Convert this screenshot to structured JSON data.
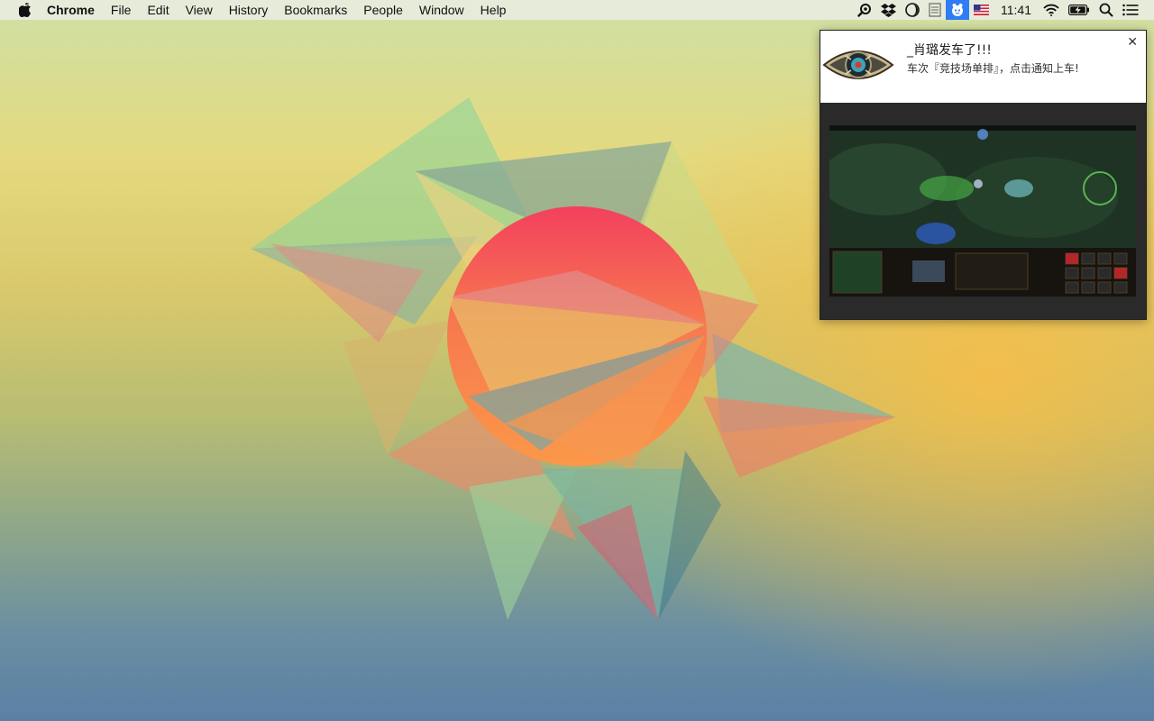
{
  "menubar": {
    "app_name": "Chrome",
    "menus": [
      "File",
      "Edit",
      "View",
      "History",
      "Bookmarks",
      "People",
      "Window",
      "Help"
    ],
    "clock": "11:41",
    "tray_icons": [
      "apple-logo-icon",
      "search-magnifier-icon",
      "dropbox-icon",
      "moon-contrast-icon",
      "reading-list-icon",
      "chat-bot-icon",
      "us-flag-icon",
      "wifi-icon",
      "battery-charging-icon",
      "spotlight-icon",
      "notification-center-icon"
    ]
  },
  "notification": {
    "title": "_肖璐发车了!!!",
    "message": "车次『竞技场单排』，点击通知上车!",
    "close_glyph": "✕",
    "icon": "eye-logo-icon",
    "image": "game-screenshot-image"
  },
  "colors": {
    "menubar_bg": "#e8ecde",
    "tray_highlight": "#2f7cf6",
    "notification_bg": "#2a2a2a",
    "sun_red": "#f2445c",
    "sun_orange": "#f9a24a"
  }
}
